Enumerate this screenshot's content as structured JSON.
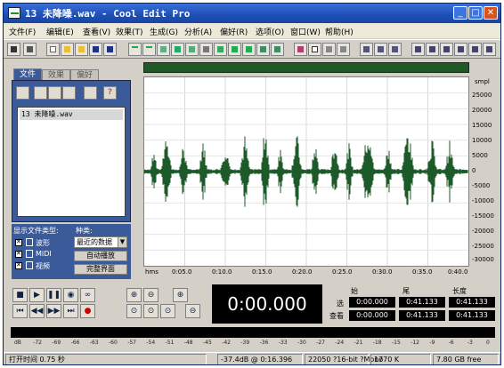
{
  "window": {
    "title": "13 未降噪.wav - Cool Edit Pro",
    "controls": [
      "_",
      "□",
      "✕"
    ]
  },
  "menu": [
    "文件(F)",
    "编辑(E)",
    "查看(V)",
    "效果(T)",
    "生成(G)",
    "分析(A)",
    "偏好(R)",
    "选项(O)",
    "窗口(W)",
    "帮助(H)"
  ],
  "left_panel": {
    "tabs": [
      "文件",
      "效果",
      "偏好"
    ],
    "file_name": "13 未降噪.wav",
    "show_types_label": "显示文件类型:",
    "type_items": [
      "波形",
      "MIDI",
      "视频"
    ],
    "sort_label": "种类:",
    "sort_value": "最近的数据",
    "auto_play_button": "自动播放",
    "full_name_button": "完整界面"
  },
  "wave": {
    "unit": "smpl",
    "y_ticks": [
      "25000",
      "20000",
      "15000",
      "10000",
      "5000",
      "0",
      "-5000",
      "-10000",
      "-15000",
      "-20000",
      "-25000",
      "-30000"
    ],
    "time_unit": "hms",
    "time_ticks": [
      "0:05.0",
      "0:10.0",
      "0:15.0",
      "0:20.0",
      "0:25.0",
      "0:30.0",
      "0:35.0",
      "0:40.0"
    ]
  },
  "transport": {
    "time_display": "0:00.000"
  },
  "selection": {
    "headers": [
      "始",
      "尾",
      "长度"
    ],
    "row_labels": [
      "选",
      "查看"
    ],
    "select": [
      "0:00.000",
      "0:41.133",
      "0:41.133"
    ],
    "view": [
      "0:00.000",
      "0:41.133",
      "0:41.133"
    ]
  },
  "level_ticks": [
    "dB",
    "-72",
    "-69",
    "-66",
    "-63",
    "-60",
    "-57",
    "-54",
    "-51",
    "-48",
    "-45",
    "-42",
    "-39",
    "-36",
    "-33",
    "-30",
    "-27",
    "-24",
    "-21",
    "-18",
    "-15",
    "-12",
    "-9",
    "-6",
    "-3",
    "0"
  ],
  "status": {
    "open_time": "打开时间 0.75 秒",
    "level": "-37.4dB @ 0:16.396",
    "format": "22050 ?16-bit ?Mono",
    "size": "1770 K",
    "free": "7.80 GB free"
  }
}
